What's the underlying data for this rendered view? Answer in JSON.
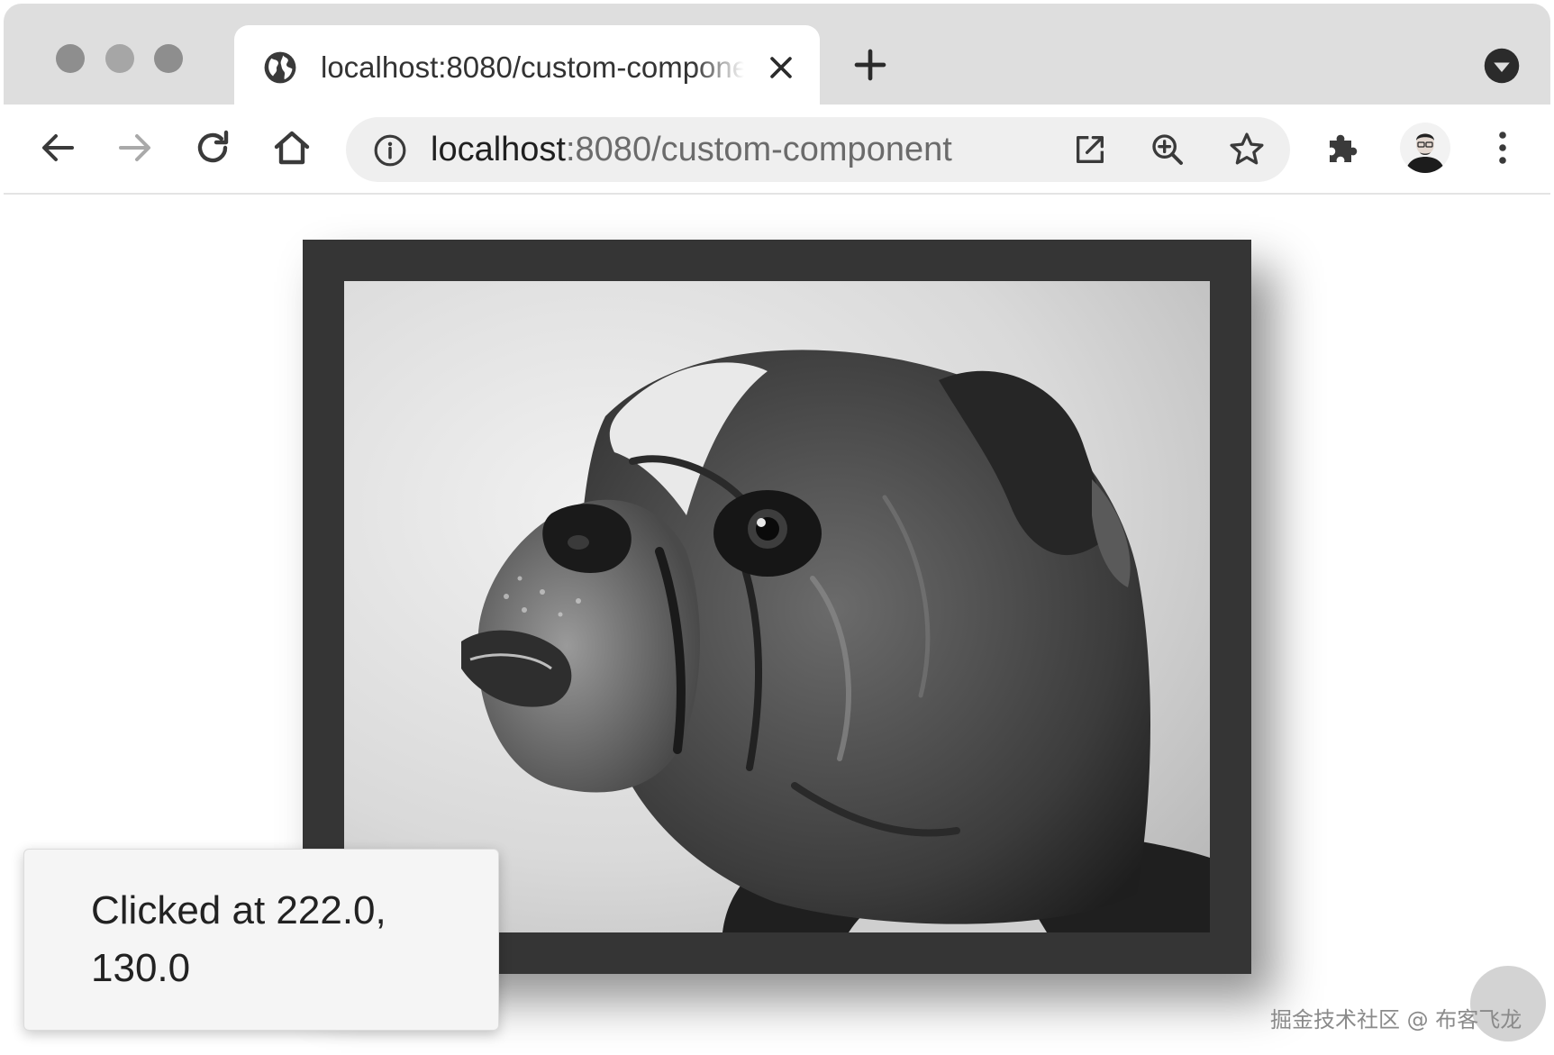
{
  "browser": {
    "tab": {
      "title": "localhost:8080/custom-component",
      "favicon": "globe-icon"
    },
    "toolbar": {
      "back_icon": "arrow-left-icon",
      "forward_icon": "arrow-right-icon",
      "reload_icon": "reload-icon",
      "home_icon": "home-icon",
      "extensions_icon": "puzzle-icon",
      "menu_icon": "kebab-menu-icon"
    },
    "omnibox": {
      "info_icon": "info-icon",
      "url_host": "localhost",
      "url_rest": ":8080/custom-component",
      "open_icon": "open-in-window-icon",
      "zoom_icon": "zoom-in-icon",
      "bookmark_icon": "star-icon"
    }
  },
  "page": {
    "image_subject": "black and white photo of a bulldog",
    "snackbar": {
      "text": "Clicked at 222.0, 130.0"
    }
  },
  "watermark": {
    "text": "掘金技术社区 @ 布客飞龙"
  },
  "colors": {
    "tabstrip_bg": "#dedede",
    "omnibox_bg": "#efefef",
    "frame_border": "#353535",
    "snackbar_bg": "#f5f5f5"
  }
}
